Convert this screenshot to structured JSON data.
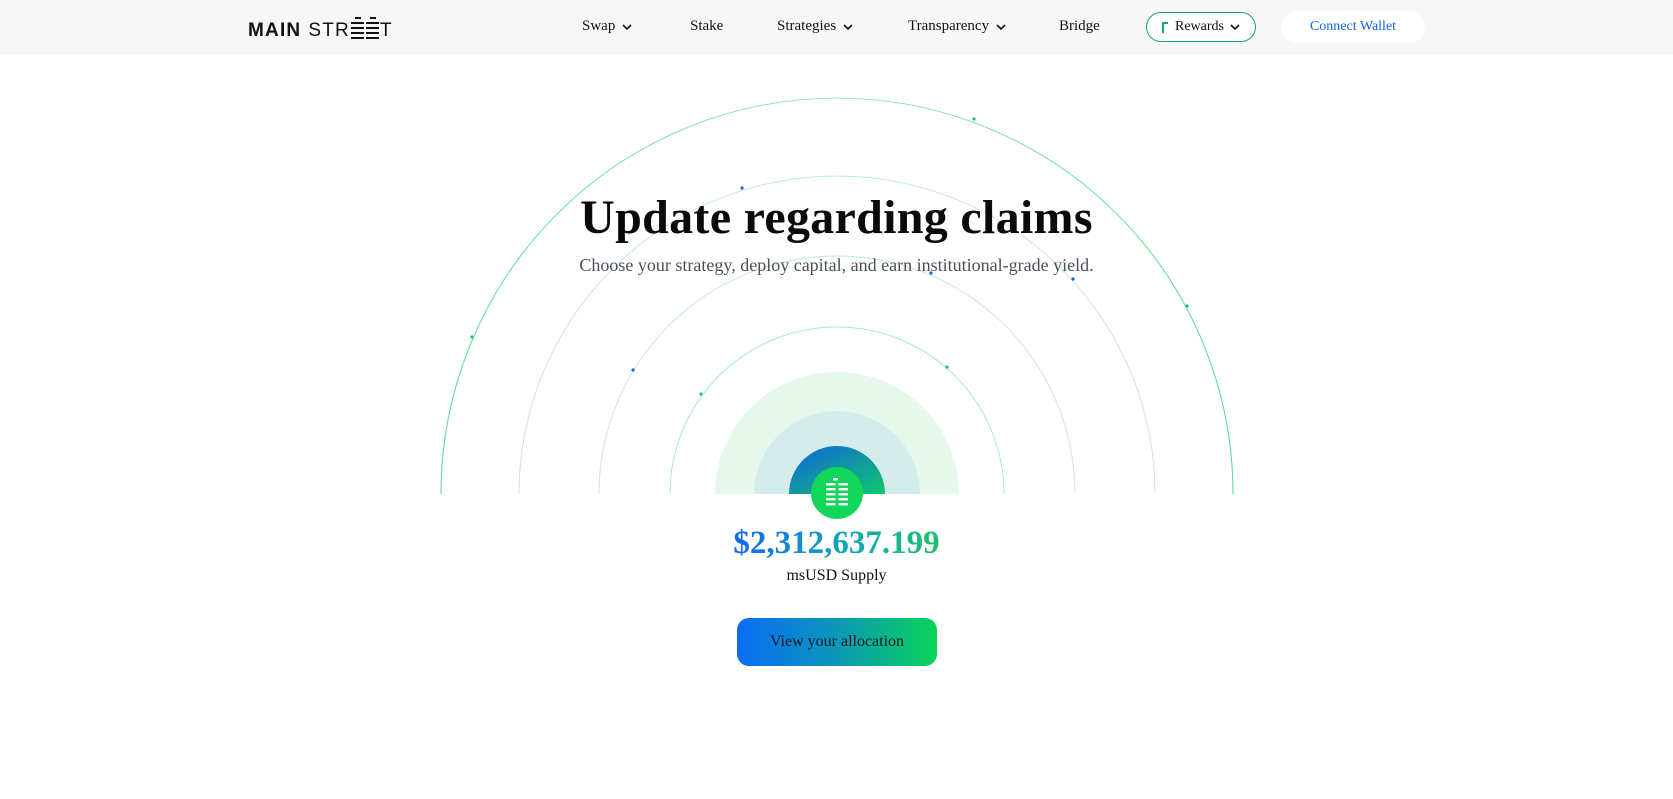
{
  "brand": {
    "logo_main": "MAIN",
    "logo_street_prefix": "STR",
    "logo_street_suffix": "T"
  },
  "nav": {
    "items": [
      {
        "label": "Swap",
        "has_dropdown": true
      },
      {
        "label": "Stake",
        "has_dropdown": false
      },
      {
        "label": "Strategies",
        "has_dropdown": true
      },
      {
        "label": "Transparency",
        "has_dropdown": true
      },
      {
        "label": "Bridge",
        "has_dropdown": false
      }
    ],
    "rewards_label": "Rewards",
    "connect_wallet_label": "Connect Wallet"
  },
  "hero": {
    "title": "Update regarding claims",
    "subtitle": "Choose your strategy, deploy capital, and earn institutional-grade yield."
  },
  "stats": {
    "supply_value": "$2,312,637.199",
    "supply_label": "msUSD Supply"
  },
  "cta": {
    "label": "View your allocation"
  },
  "colors": {
    "accent_blue": "#1263e8",
    "accent_green": "#0ad456",
    "ring_green": "#7be3a4",
    "ring_blue": "#b9d3f4",
    "topbar_bg": "#f7f7f7"
  },
  "icons": {
    "hub_icon": "msusd-token-icon",
    "rewards_icon": "rewards-flag-icon",
    "dropdown_icon": "chevron-down-icon"
  }
}
